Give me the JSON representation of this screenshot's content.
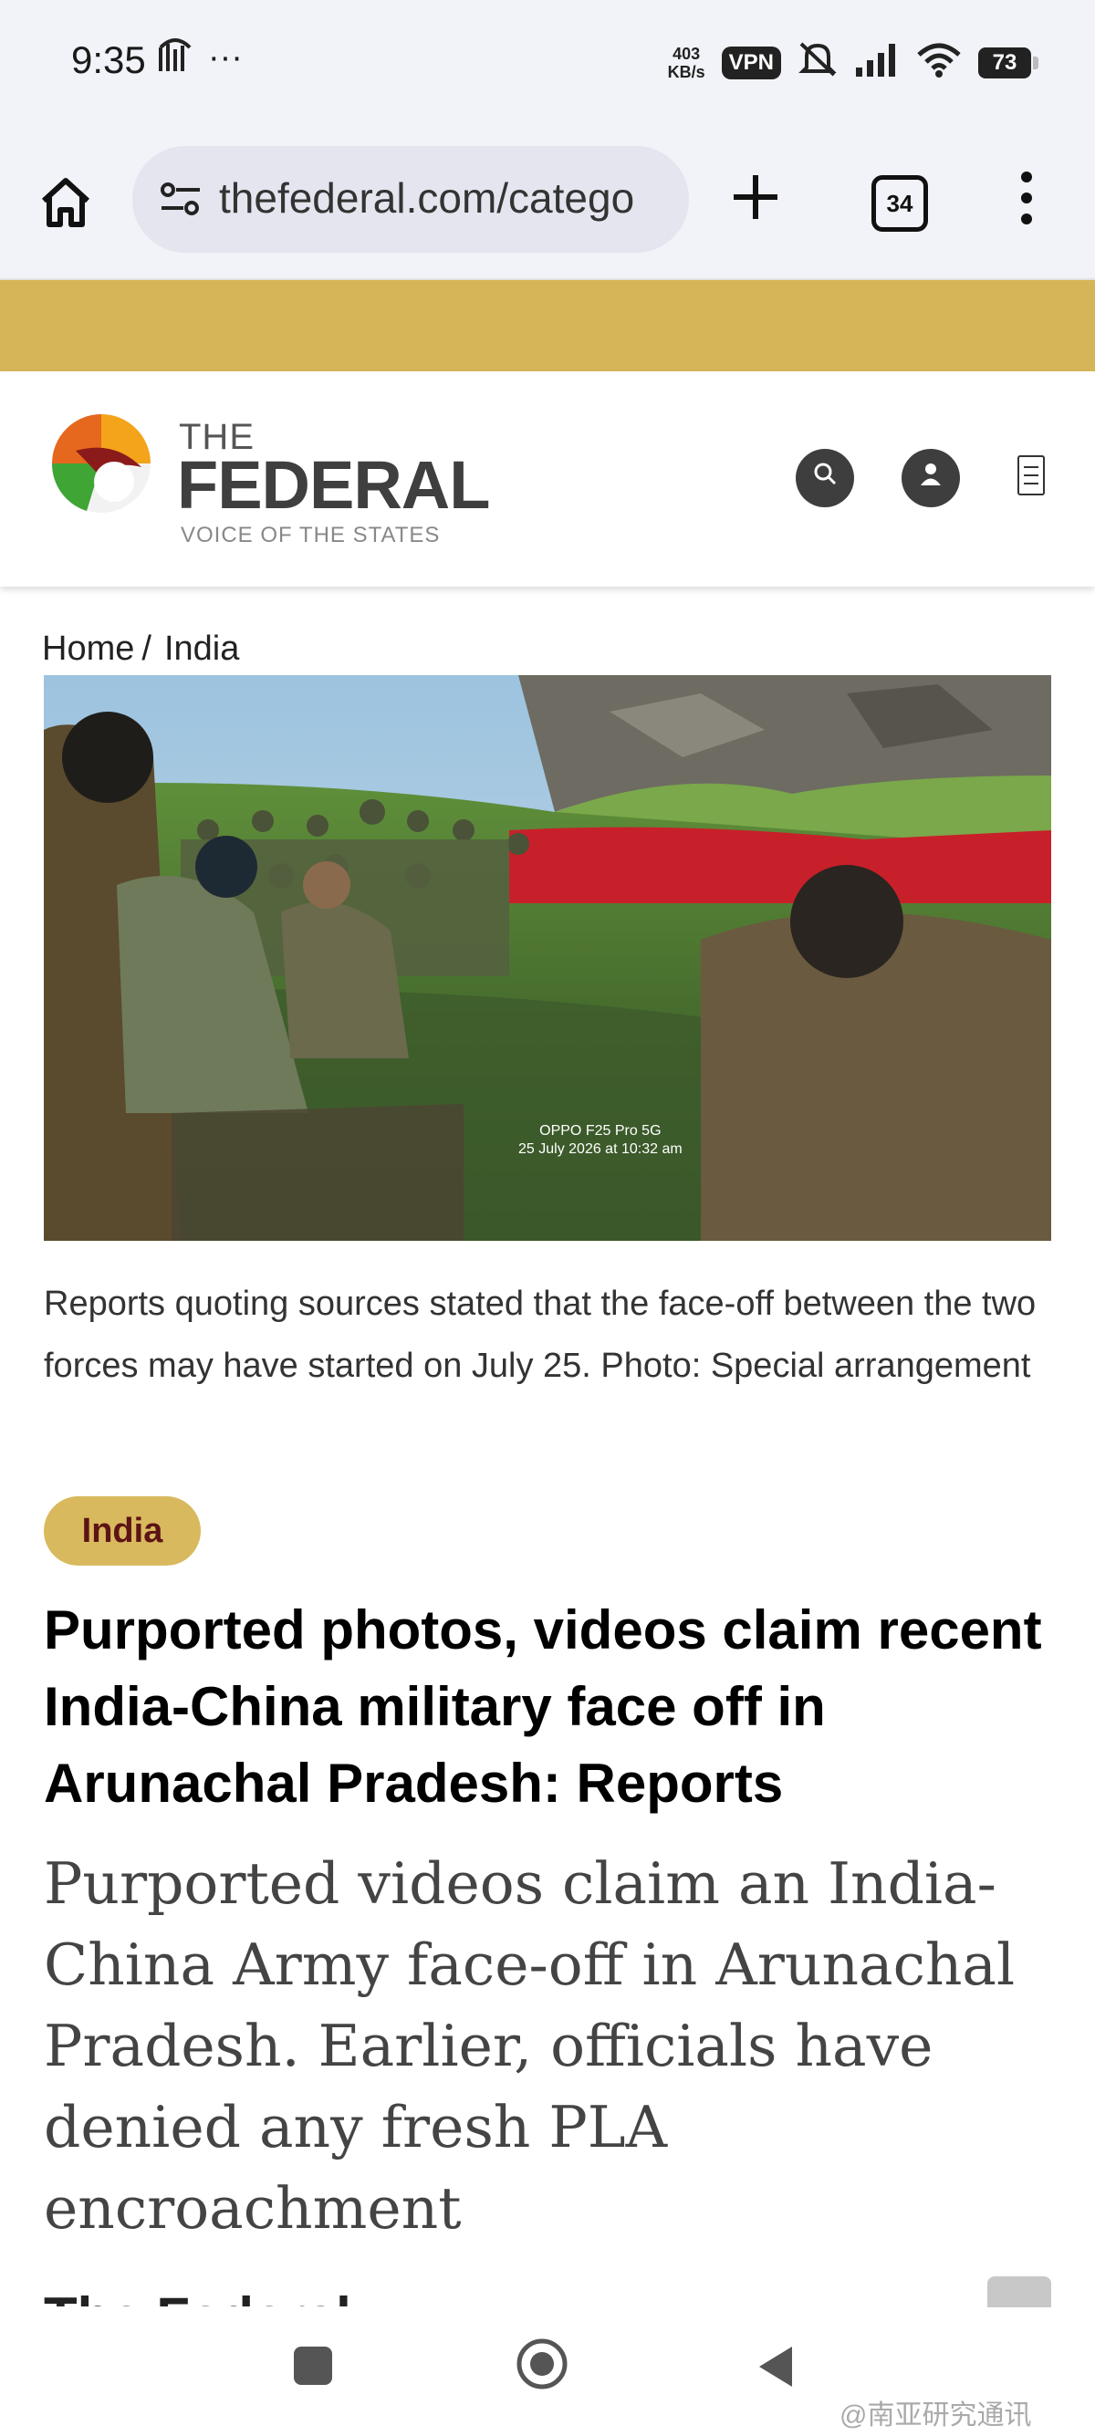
{
  "status_bar": {
    "time": "9:35",
    "notification_icons": [
      "signal-app-icon",
      "more-dots-icon"
    ],
    "more": "···",
    "net_speed_value": "403",
    "net_speed_unit": "KB/s",
    "vpn": "VPN",
    "battery": "73"
  },
  "browser": {
    "url": "thefederal.com/catego",
    "tab_count": "34"
  },
  "site_header": {
    "brand_the": "THE",
    "brand_name": "FEDERAL",
    "tagline": "VOICE OF THE STATES",
    "icons": [
      "search-icon",
      "user-icon",
      "menu-icon"
    ]
  },
  "breadcrumb": {
    "home": "Home",
    "separator": "/",
    "current": "India"
  },
  "photo": {
    "camera_stamp": "OPPO F25 Pro 5G",
    "date_stamp": "25 July 2026 at 10:32 am"
  },
  "article": {
    "caption": "Reports quoting sources stated that the face-off between the two forces may have started on July 25. Photo: Special arrangement",
    "category": "India",
    "headline": "Purported photos, videos claim recent India-China military face off in Arunachal Pradesh: Reports",
    "summary": "Purported videos claim an India-China Army face-off in Arunachal Pradesh. Earlier, officials have denied any fresh PLA encroachment",
    "source": "The Federal"
  },
  "watermark": "@南亚研究通讯",
  "colors": {
    "ad_strip": "#d5b557",
    "category_pill": "#d9b95e",
    "category_text": "#5c1414"
  }
}
